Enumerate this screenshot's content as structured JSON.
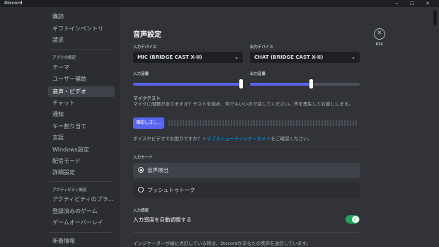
{
  "window": {
    "title": "Discord",
    "minimize": "─",
    "maximize": "☐",
    "close": "✕"
  },
  "sidebar": {
    "items_top": [
      "購読",
      "ギフトインベントリ",
      "請求"
    ],
    "section_app": "アプリの設定",
    "items_app": [
      "テーマ",
      "ユーザー補助",
      "音声・ビデオ",
      "チャット",
      "通知",
      "キー割り当て",
      "言語",
      "Windows設定",
      "配信モード",
      "詳細設定"
    ],
    "active_item": "音声・ビデオ",
    "section_activity": "アクティビティ設定",
    "items_activity": [
      "アクティビティのプラ...",
      "登録済みのゲーム",
      "ゲームオーバーレイ"
    ],
    "items_bottom": [
      "新着情報"
    ]
  },
  "main": {
    "title": "音声設定",
    "input_device_label": "入力デバイス",
    "input_device_value": "MIC (BRIDGE CAST X-II)",
    "output_device_label": "出力デバイス",
    "output_device_value": "CHAT (BRIDGE CAST X-II)",
    "input_volume_label": "入力音量",
    "input_volume": 1.0,
    "output_volume_label": "出力音量",
    "output_volume": 0.56,
    "mic_test_label": "マイクテスト",
    "mic_test_desc": "マイクに問題がありますか？テストを始め、何でもいいので話してください。声を再生してお返しします。",
    "check_button": "確認しまし...",
    "help_text_prefix": "ボイスやビデオでお困りですか？",
    "help_link": "トラブルシューティング・ガイド",
    "help_text_suffix": "をご確認ください。",
    "input_mode_label": "入力モード",
    "mode_voice_activity": "音声検出",
    "mode_push_to_talk": "プッシュトゥトーク",
    "sensitivity_label": "入力感度",
    "auto_sensitivity": "入力感度を自動調整する",
    "auto_sensitivity_on": true,
    "indicator_note": "インジケーターが緑に点灯している時は、Discordがあなたの美声を送信しています。",
    "esc_label": "ESC"
  },
  "colors": {
    "accent": "#5865f2",
    "toggle_on": "#23a55a",
    "link": "#00a8fc"
  }
}
